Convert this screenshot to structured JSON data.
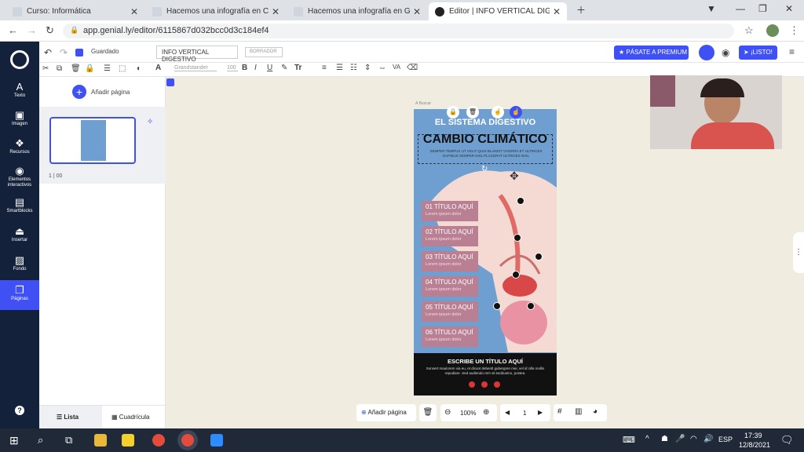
{
  "browser": {
    "tabs": [
      {
        "title": "Curso: Informática"
      },
      {
        "title": "Hacemos una infografía en CANVA"
      },
      {
        "title": "Hacemos una infografía en Genially"
      },
      {
        "title": "Editor | INFO VERTICAL DIGESTIVO"
      }
    ],
    "url": "app.genial.ly/editor/6115867d032bcc0d3c184ef4"
  },
  "rail": [
    {
      "label": "Texto",
      "icon": "text-icon"
    },
    {
      "label": "Imagen",
      "icon": "image-icon"
    },
    {
      "label": "Recursos",
      "icon": "resources-icon"
    },
    {
      "label": "Elementos interactivos",
      "icon": "interactive-icon"
    },
    {
      "label": "Smartblocks",
      "icon": "smartblocks-icon"
    },
    {
      "label": "Insertar",
      "icon": "insert-icon"
    },
    {
      "label": "Fondo",
      "icon": "background-icon"
    },
    {
      "label": "Páginas",
      "icon": "pages-icon"
    }
  ],
  "toolbar": {
    "saved": "Guardado",
    "doc_title": "INFO VERTICAL DIGESTIVO",
    "draft_badge": "BORRADOR",
    "premium": "PÁSATE A PREMIUM",
    "ready": "¡LISTO!",
    "font": "Grandstander",
    "font_size": "100"
  },
  "panel": {
    "add_page": "Añadir página",
    "page_label": "1 | 00",
    "list": "Lista",
    "grid": "Cuadrícula"
  },
  "infographic": {
    "small_label": "A Buscar",
    "title": "EL SISTEMA DIGESTIVO",
    "overlay_title": "CAMBIO CLIMÁTICO",
    "blurb": "SEMPER TEMPUS UT VELIT QUIS BLANDIT VIVERRA ET ULTRICES DAPIBUS SEMPER NISL PLACERAT ULTRICES NISL",
    "items": [
      {
        "title": "01 TÍTULO AQUÍ",
        "sub": "Lorem ipsum dolor"
      },
      {
        "title": "02 TÍTULO AQUÍ",
        "sub": "Lorem ipsum dolor"
      },
      {
        "title": "03 TÍTULO AQUÍ",
        "sub": "Lorem ipsum dolor"
      },
      {
        "title": "04 TÍTULO AQUÍ",
        "sub": "Lorem ipsum dolor"
      },
      {
        "title": "05 TÍTULO AQUÍ",
        "sub": "Lorem ipsum dolor"
      },
      {
        "title": "06 TÍTULO AQUÍ",
        "sub": "Lorem ipsum dolor"
      }
    ],
    "footer_title": "ESCRIBE UN TÍTULO AQUÍ",
    "footer_text": "Sonsert maulorem via eu, et dicunt debentl gubergren mei, vel id cilla mollis repudiare. Sed audiendo rem sit tacibusino, postea."
  },
  "bottom_bar": {
    "add_page": "Añadir página",
    "zoom": "100%",
    "page": "1"
  },
  "taskbar": {
    "lang": "ESP",
    "time": "17:39",
    "date": "12/8/2021"
  },
  "colors": {
    "rail": "#14213a",
    "accent": "#3f51f5",
    "info_bg": "#6e9fd0",
    "item": "#b97f92"
  }
}
